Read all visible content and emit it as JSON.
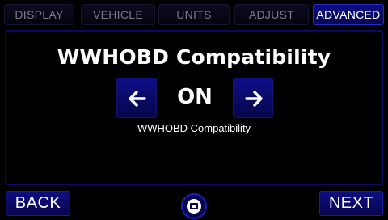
{
  "tabs": [
    {
      "label": "DISPLAY",
      "active": false
    },
    {
      "label": "VEHICLE",
      "active": false
    },
    {
      "label": "UNITS",
      "active": false
    },
    {
      "label": "ADJUST",
      "active": false
    },
    {
      "label": "ADVANCED",
      "active": true
    }
  ],
  "setting": {
    "title": "WWHOBD Compatibility",
    "value": "ON",
    "description": "WWHOBD Compatibility",
    "prev_icon": "arrow-left-icon",
    "next_icon": "arrow-right-icon"
  },
  "footer": {
    "back_label": "BACK",
    "next_label": "NEXT",
    "home_icon": "home-icon"
  },
  "colors": {
    "background": "#000000",
    "button_blue": "#0a0a70",
    "active_tab": "#0d0d82",
    "inactive_text": "#7a7a86",
    "text": "#ffffff"
  }
}
